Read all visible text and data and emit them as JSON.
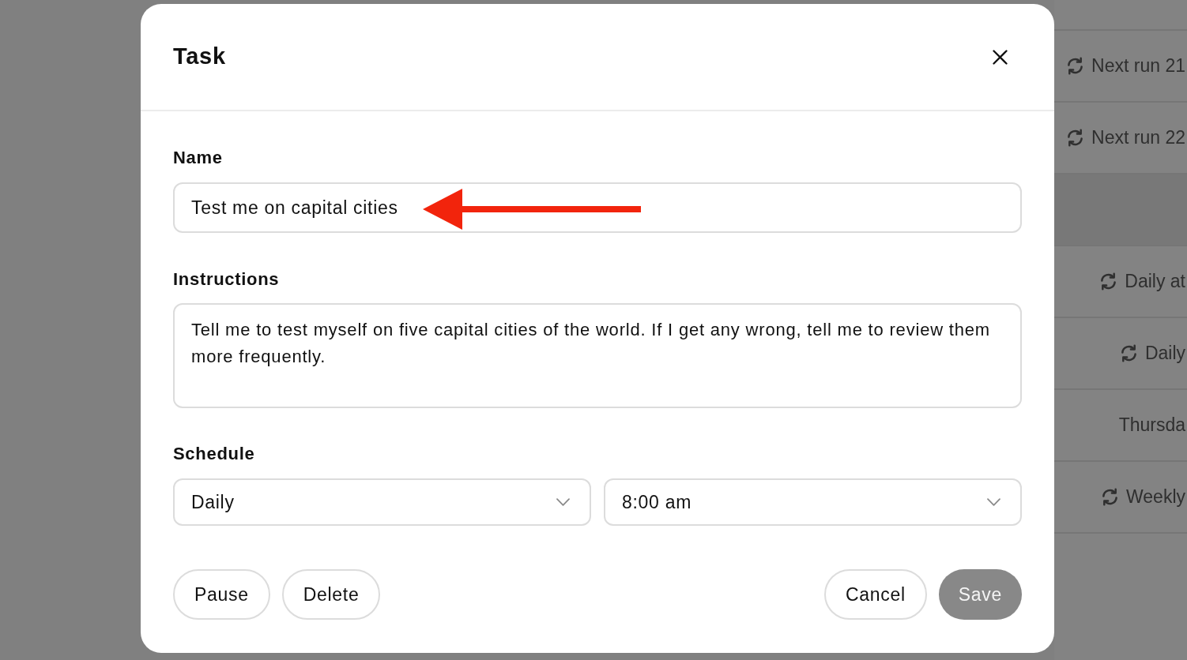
{
  "background": {
    "rows": [
      {
        "kind": "recurring",
        "text": "Next run 21"
      },
      {
        "kind": "recurring",
        "text": "Next run 22"
      },
      {
        "kind": "highlighted"
      },
      {
        "kind": "recurring",
        "text": "Daily at"
      },
      {
        "kind": "recurring",
        "text": "Daily"
      },
      {
        "kind": "plain",
        "text": "Thursda"
      },
      {
        "kind": "recurring",
        "text": "Weekly"
      }
    ]
  },
  "dialog": {
    "title": "Task",
    "name": {
      "label": "Name",
      "value": "Test me on capital cities"
    },
    "instructions": {
      "label": "Instructions",
      "value": "Tell me to test myself on five capital cities of the world. If I get any wrong, tell me to review them more frequently."
    },
    "schedule": {
      "label": "Schedule",
      "frequency": "Daily",
      "time": "8:00 am"
    },
    "start_buttons": [
      {
        "label": "Pause",
        "kind": "secondary",
        "disabled": false
      },
      {
        "label": "Delete",
        "kind": "secondary",
        "disabled": false
      }
    ],
    "end_buttons": [
      {
        "label": "Cancel",
        "kind": "secondary",
        "disabled": false
      },
      {
        "label": "Save",
        "kind": "primary",
        "disabled": true
      }
    ]
  }
}
